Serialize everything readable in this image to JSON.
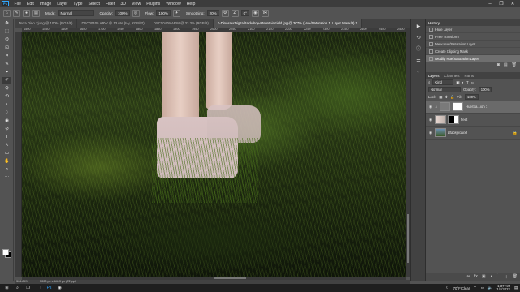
{
  "app": {
    "logo": "Ps"
  },
  "menubar": {
    "items": [
      "File",
      "Edit",
      "Image",
      "Layer",
      "Type",
      "Select",
      "Filter",
      "3D",
      "View",
      "Plugins",
      "Window",
      "Help"
    ]
  },
  "window_controls": {
    "minimize": "–",
    "maximize": "❐",
    "close": "✕"
  },
  "options": {
    "mode_label": "Mode:",
    "mode_value": "Normal",
    "opacity_label": "Opacity:",
    "opacity_value": "100%",
    "flow_label": "Flow:",
    "flow_value": "100%",
    "smoothing_label": "Smoothing:",
    "smoothing_value": "20%",
    "angle_value": "0°"
  },
  "tabs": [
    {
      "label": "Terra Dino Zjung @ 100% (RGB/8)"
    },
    {
      "label": "DSC00405.ARW @ 13.6% (Ivy, RGB/8*)"
    },
    {
      "label": "DSC00409.ARW @ 33.3% (RGB/8)"
    },
    {
      "label": "1-DinosaurDigitalBackdrop-MountainField.jpg @ 307% (Hue/Saturation 1, Layer Mask/8) *"
    }
  ],
  "ruler": {
    "ticks": [
      "1500",
      "1550",
      "1600",
      "1650",
      "1700",
      "1750",
      "1800",
      "1850",
      "1900",
      "1950",
      "2000",
      "2050",
      "2100",
      "2150",
      "2200",
      "2250",
      "2300",
      "2350",
      "2400",
      "2450",
      "2500"
    ]
  },
  "toolbar": {
    "tools": [
      "✥",
      "⬚",
      "ʘ",
      "⊡",
      "⌗",
      "✎",
      "⌖",
      "✐",
      "⛭",
      "⟲",
      "◐",
      "♢",
      "◉",
      "⊘",
      "T",
      "↖",
      "▭",
      "✋",
      "⌕",
      "⋯"
    ]
  },
  "status": {
    "zoom": "306.84%",
    "doc": "5000 px x 4419 px (72 ppi)"
  },
  "history": {
    "tab": "History",
    "items": [
      {
        "label": "Hide Layer"
      },
      {
        "label": "Free Transform"
      },
      {
        "label": "New Hue/Saturation Layer"
      },
      {
        "label": "Create Clipping Mask"
      },
      {
        "label": "Modify Hue/Saturation Layer"
      }
    ]
  },
  "layers_panel": {
    "tabs": [
      "Layers",
      "Channels",
      "Paths"
    ],
    "filter_kind": "Kind",
    "blend_mode": "Normal",
    "opacity_label": "Opacity:",
    "opacity_value": "100%",
    "lock_label": "Lock:",
    "fill_label": "Fill:",
    "fill_value": "100%",
    "layers": [
      {
        "name": "Hue/Sa...ion 1"
      },
      {
        "name": "feet"
      },
      {
        "name": "Background"
      }
    ],
    "footer_icons": [
      "fx",
      "◑",
      "▣",
      "🗀",
      "＋",
      "🗑"
    ]
  },
  "taskbar": {
    "weather": "70°F Clear",
    "time": "1:37 AM",
    "date": "1/1/2022"
  }
}
